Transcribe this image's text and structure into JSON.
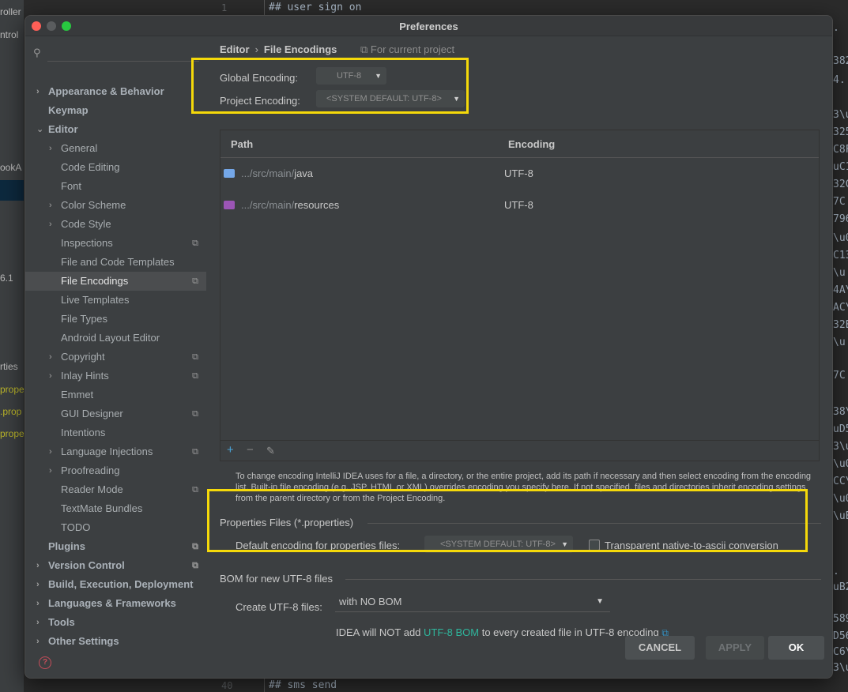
{
  "background": {
    "project_items": [
      "roller",
      "ntrol",
      "ookA",
      "6.1",
      "rties",
      "prope",
      ".prop",
      "prope"
    ],
    "line_top": "1",
    "code_top": "## user sign on",
    "line_bottom": "40",
    "code_bottom": "## sms send",
    "right_fragments": [
      ".",
      "382",
      "4.",
      "3\\u",
      "325",
      "C8F",
      "uC1",
      "32C",
      "7C",
      "796",
      "\\u0",
      "C13",
      "\\u",
      "4A\\",
      "AC\\",
      "32E",
      "\\u",
      "7C",
      "38\\",
      "uD5",
      "3\\u",
      "\\u0",
      "CC\\",
      "\\u0",
      "\\uE",
      ".",
      "uB2",
      "589",
      "D56",
      "C6\\",
      "3\\u"
    ]
  },
  "window": {
    "title": "Preferences"
  },
  "sidebar": {
    "search_placeholder": "",
    "items": [
      {
        "label": "Appearance & Behavior",
        "level": 0,
        "chevron": "›",
        "bold": true
      },
      {
        "label": "Keymap",
        "level": 0,
        "chevron": "",
        "bold": true
      },
      {
        "label": "Editor",
        "level": 0,
        "chevron": "⌄",
        "bold": true
      },
      {
        "label": "General",
        "level": 1,
        "chevron": "›"
      },
      {
        "label": "Code Editing",
        "level": 1,
        "chevron": ""
      },
      {
        "label": "Font",
        "level": 1,
        "chevron": ""
      },
      {
        "label": "Color Scheme",
        "level": 1,
        "chevron": "›"
      },
      {
        "label": "Code Style",
        "level": 1,
        "chevron": "›"
      },
      {
        "label": "Inspections",
        "level": 1,
        "chevron": "",
        "project": true
      },
      {
        "label": "File and Code Templates",
        "level": 1,
        "chevron": ""
      },
      {
        "label": "File Encodings",
        "level": 1,
        "chevron": "",
        "project": true,
        "selected": true
      },
      {
        "label": "Live Templates",
        "level": 1,
        "chevron": ""
      },
      {
        "label": "File Types",
        "level": 1,
        "chevron": ""
      },
      {
        "label": "Android Layout Editor",
        "level": 1,
        "chevron": ""
      },
      {
        "label": "Copyright",
        "level": 1,
        "chevron": "›",
        "project": true
      },
      {
        "label": "Inlay Hints",
        "level": 1,
        "chevron": "›",
        "project": true
      },
      {
        "label": "Emmet",
        "level": 1,
        "chevron": ""
      },
      {
        "label": "GUI Designer",
        "level": 1,
        "chevron": "",
        "project": true
      },
      {
        "label": "Intentions",
        "level": 1,
        "chevron": ""
      },
      {
        "label": "Language Injections",
        "level": 1,
        "chevron": "›",
        "project": true
      },
      {
        "label": "Proofreading",
        "level": 1,
        "chevron": "›"
      },
      {
        "label": "Reader Mode",
        "level": 1,
        "chevron": "",
        "project": true
      },
      {
        "label": "TextMate Bundles",
        "level": 1,
        "chevron": ""
      },
      {
        "label": "TODO",
        "level": 1,
        "chevron": ""
      },
      {
        "label": "Plugins",
        "level": 0,
        "chevron": "",
        "bold": true,
        "project": true
      },
      {
        "label": "Version Control",
        "level": 0,
        "chevron": "›",
        "bold": true,
        "project": true
      },
      {
        "label": "Build, Execution, Deployment",
        "level": 0,
        "chevron": "›",
        "bold": true
      },
      {
        "label": "Languages & Frameworks",
        "level": 0,
        "chevron": "›",
        "bold": true
      },
      {
        "label": "Tools",
        "level": 0,
        "chevron": "›",
        "bold": true
      },
      {
        "label": "Other Settings",
        "level": 0,
        "chevron": "›",
        "bold": true
      }
    ]
  },
  "breadcrumb": {
    "parent": "Editor",
    "separator": "›",
    "current": "File Encodings",
    "scope": "For current project"
  },
  "encodings": {
    "global_label": "Global Encoding:",
    "global_value": "UTF-8",
    "project_label": "Project Encoding:",
    "project_value": "<SYSTEM DEFAULT: UTF-8>"
  },
  "table": {
    "col_path": "Path",
    "col_encoding": "Encoding",
    "rows": [
      {
        "prefix": ".../src/main/",
        "name": "java",
        "encoding": "UTF-8"
      },
      {
        "prefix": ".../src/main/",
        "name": "resources",
        "encoding": "UTF-8"
      }
    ],
    "add": "+",
    "remove": "−",
    "edit": "✎"
  },
  "help_text": "To change encoding IntelliJ IDEA uses for a file, a directory, or the entire project, add its path if necessary and then select encoding from the encoding list. Built-in file encoding (e.g. JSP, HTML or XML) overrides encoding you specify here. If not specified, files and directories inherit encoding settings from the parent directory or from the Project Encoding.",
  "properties": {
    "section": "Properties Files (*.properties)",
    "default_label": "Default encoding for properties files:",
    "default_value": "<SYSTEM DEFAULT: UTF-8>",
    "transparent_label": "Transparent native-to-ascii conversion"
  },
  "bom": {
    "section": "BOM for new UTF-8 files",
    "create_label": "Create UTF-8 files:",
    "create_value": "with NO BOM",
    "note_before": "IDEA will NOT add ",
    "note_link": "UTF-8 BOM",
    "note_after": " to every created file in UTF-8 encoding",
    "note_ext": "⧉"
  },
  "buttons": {
    "cancel": "CANCEL",
    "apply": "APPLY",
    "ok": "OK",
    "help": "?"
  },
  "colors": {
    "accent_highlight": "#f5d90a",
    "link": "#2fb59c",
    "ok_button": "#4c5052",
    "selection": "#4b4d4f"
  }
}
